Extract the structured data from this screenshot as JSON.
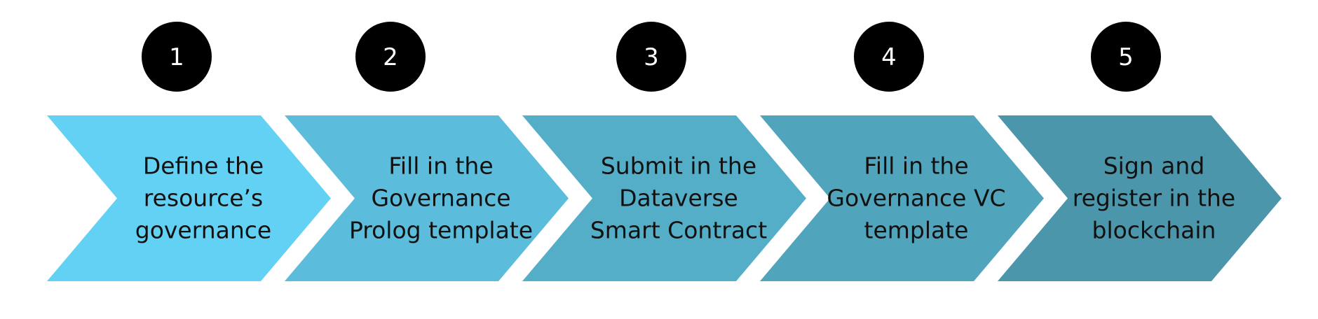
{
  "steps": [
    {
      "number": "1",
      "lines": [
        "Define the",
        "resource’s",
        "governance"
      ],
      "color": "#62d1f4"
    },
    {
      "number": "2",
      "lines": [
        "Fill in the",
        "Governance",
        "Prolog template"
      ],
      "color": "#5bbcdb"
    },
    {
      "number": "3",
      "lines": [
        "Submit in the",
        "Dataverse",
        "Smart Contract"
      ],
      "color": "#54aec7"
    },
    {
      "number": "4",
      "lines": [
        "Fill in the",
        "Governance VC",
        "template"
      ],
      "color": "#50a4bb"
    },
    {
      "number": "5",
      "lines": [
        "Sign and",
        "register in the",
        "blockchain"
      ],
      "color": "#4b96aa"
    }
  ]
}
